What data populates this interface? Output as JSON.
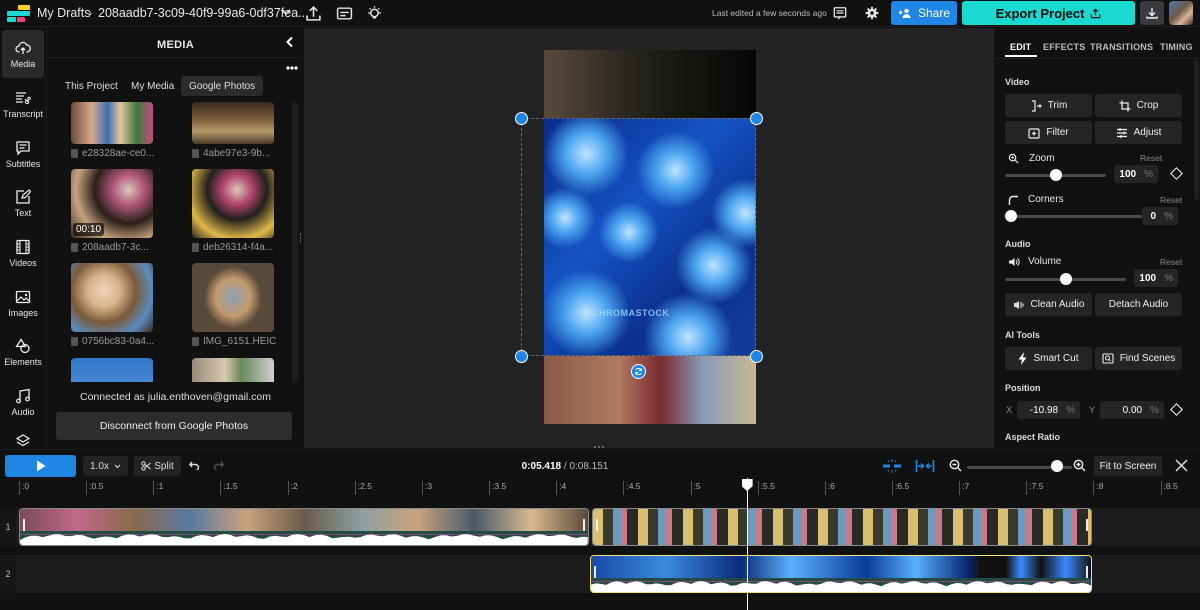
{
  "header": {
    "breadcrumb_root": "My Drafts",
    "breadcrumb_separator": "›",
    "project_name": "208aadb7-3c09-40f9-99a6-0df37fea...",
    "last_edited": "Last edited a few seconds ago",
    "share_label": "Share",
    "export_label": "Export Project",
    "brand_colors": {
      "share": "#1f86e6",
      "export": "#1ad9d0"
    }
  },
  "sidebar": {
    "items": [
      {
        "label": "Media",
        "icon": "cloud-upload-icon",
        "active": true
      },
      {
        "label": "Transcript",
        "icon": "transcript-icon"
      },
      {
        "label": "Subtitles",
        "icon": "subtitles-icon"
      },
      {
        "label": "Text",
        "icon": "text-edit-icon"
      },
      {
        "label": "Videos",
        "icon": "film-icon"
      },
      {
        "label": "Images",
        "icon": "image-icon"
      },
      {
        "label": "Elements",
        "icon": "shapes-icon"
      },
      {
        "label": "Audio",
        "icon": "music-note-icon"
      },
      {
        "label": "",
        "icon": "layers-icon"
      }
    ]
  },
  "media_panel": {
    "title": "MEDIA",
    "tabs": [
      {
        "label": "This Project"
      },
      {
        "label": "My Media"
      },
      {
        "label": "Google Photos",
        "active": true
      }
    ],
    "items": [
      {
        "name": "e28328ae-ce0..."
      },
      {
        "name": "4abe97e3-9b..."
      },
      {
        "name": "208aadb7-3c...",
        "duration": "00:10"
      },
      {
        "name": "deb26314-f4a..."
      },
      {
        "name": "0756bc83-0a4..."
      },
      {
        "name": "IMG_6151.HEIC"
      },
      {
        "name": ""
      },
      {
        "name": ""
      }
    ],
    "connected_text": "Connected as julia.enthoven@gmail.com",
    "disconnect_label": "Disconnect from Google Photos"
  },
  "canvas": {
    "overlay_watermark": "CHROMASTOCK"
  },
  "properties": {
    "tabs": [
      "EDIT",
      "EFFECTS",
      "TRANSITIONS",
      "TIMING"
    ],
    "active_tab": "EDIT",
    "video": {
      "section": "Video",
      "buttons": [
        "Trim",
        "Crop",
        "Filter",
        "Adjust"
      ],
      "zoom_label": "Zoom",
      "zoom_value": "100",
      "zoom_fraction": 0.5,
      "corners_label": "Corners",
      "corners_value": "0",
      "corners_fraction": 0.0,
      "reset_label": "Reset",
      "unit": "%"
    },
    "audio": {
      "section": "Audio",
      "volume_label": "Volume",
      "volume_value": "100",
      "volume_fraction": 0.5,
      "reset_label": "Reset",
      "unit": "%",
      "buttons": [
        "Clean Audio",
        "Detach Audio"
      ]
    },
    "ai_tools": {
      "section": "AI Tools",
      "buttons": [
        "Smart Cut",
        "Find Scenes"
      ]
    },
    "position": {
      "section": "Position",
      "x_label": "X",
      "x_value": "-10.98",
      "y_label": "Y",
      "y_value": "0.00",
      "unit": "%"
    },
    "aspect_ratio": {
      "section": "Aspect Ratio"
    }
  },
  "timeline": {
    "speed": "1.0x",
    "split_label": "Split",
    "current_time": "0:05.418",
    "total_time": "0:08.151",
    "time_separator": " / ",
    "fit_label": "Fit to Screen",
    "zoom_fraction": 0.9,
    "ruler": [
      ":0",
      ":0.5",
      ":1",
      ":1.5",
      ":2",
      ":2.5",
      ":3",
      ":3.5",
      ":4",
      ":4.5",
      ":5",
      ":5.5",
      ":6",
      ":6.5",
      ":7",
      ":7.5",
      ":8",
      ":8.5"
    ],
    "tracks": [
      {
        "label": "1",
        "clips": [
          {
            "start": 0.0,
            "end": 4.25,
            "kind": "video"
          },
          {
            "start": 4.25,
            "end": 8.0,
            "kind": "video"
          }
        ]
      },
      {
        "label": "2",
        "clips": [
          {
            "start": 4.25,
            "end": 8.0,
            "kind": "video",
            "selected": true
          }
        ]
      }
    ],
    "playhead_seconds": 5.418
  }
}
